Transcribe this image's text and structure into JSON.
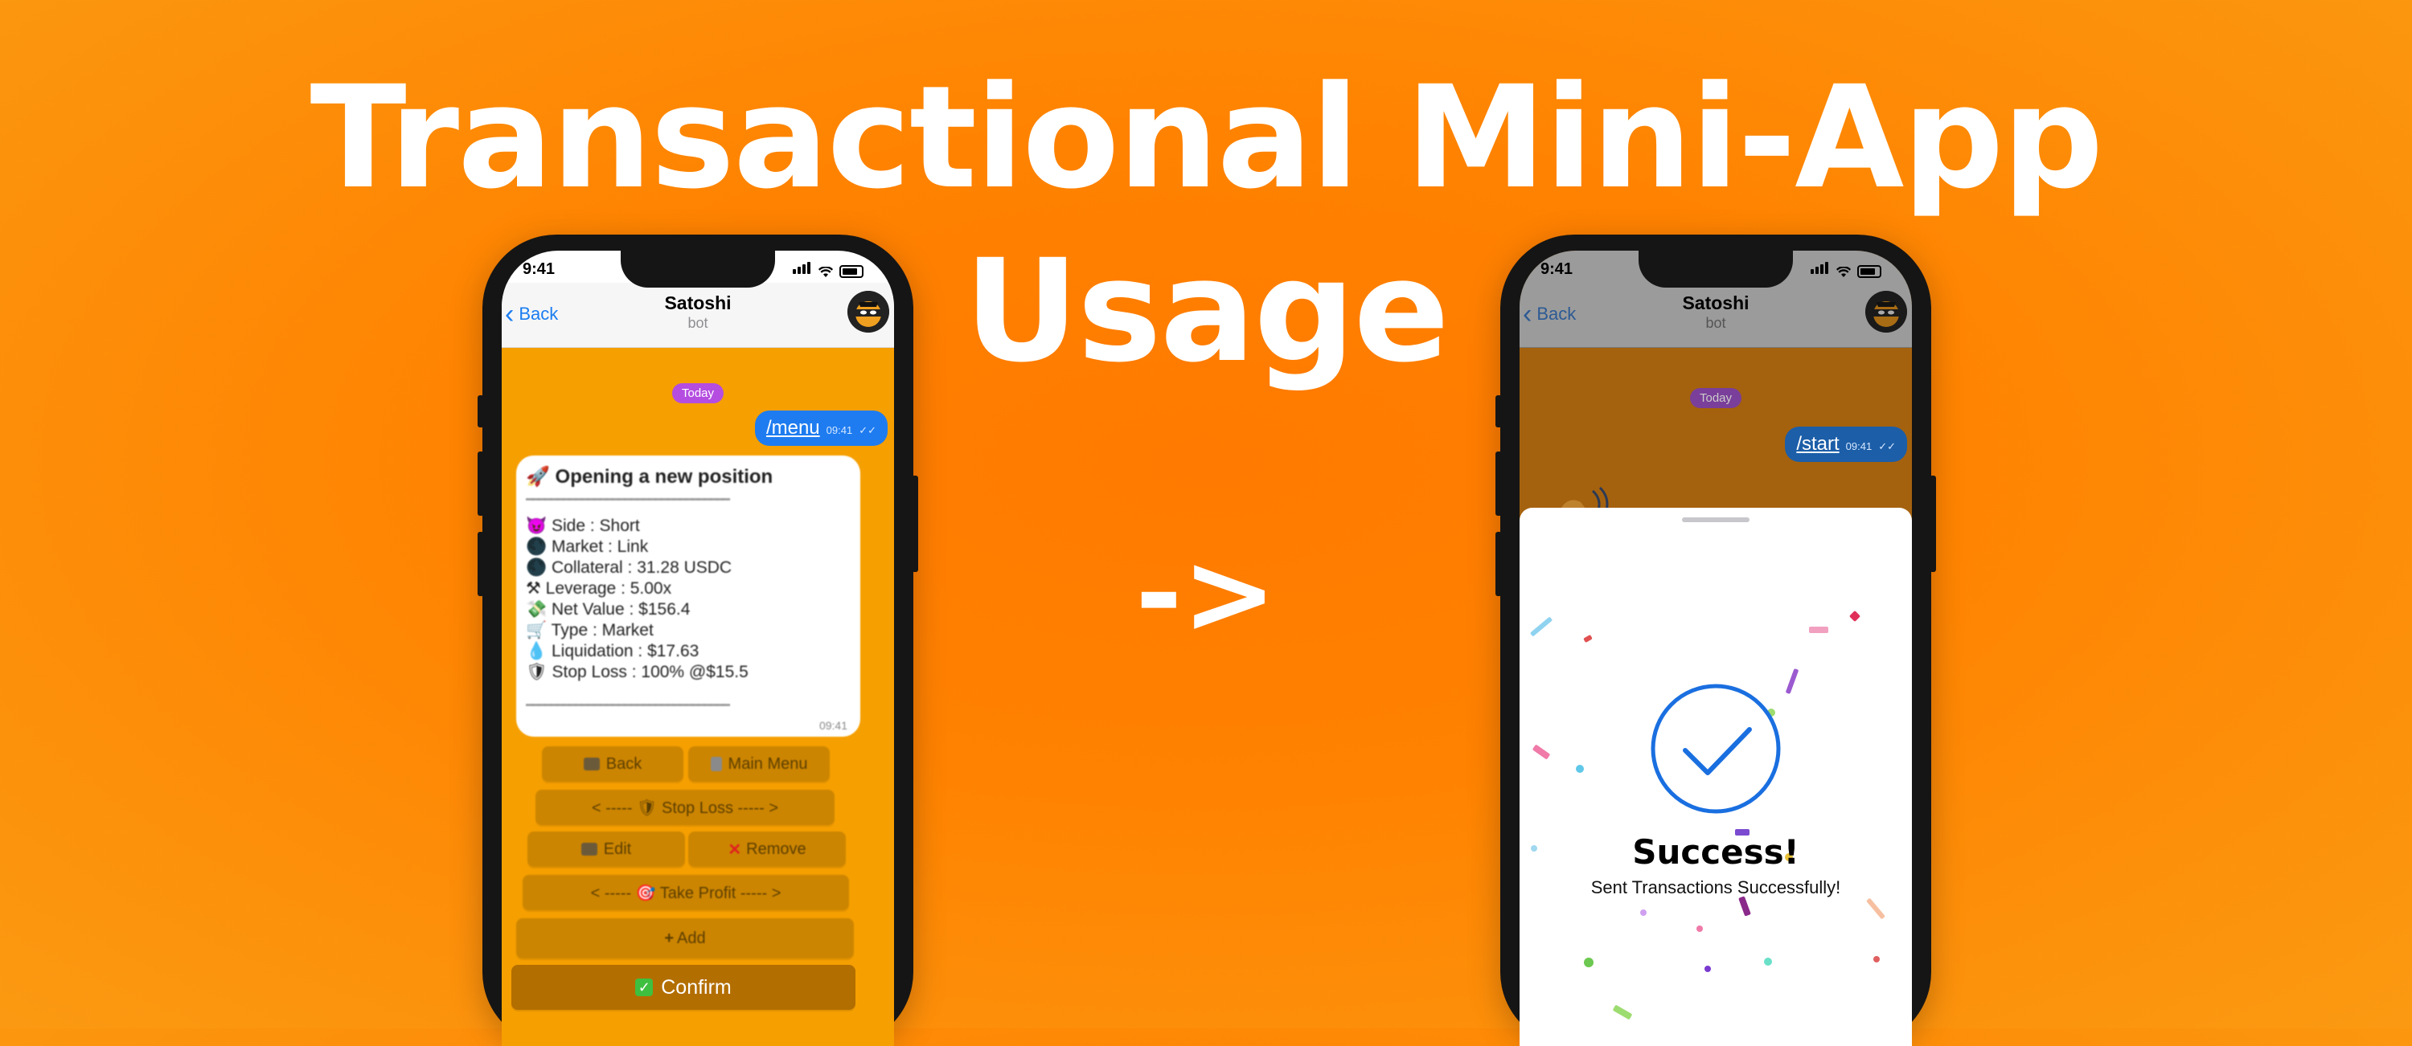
{
  "headline": {
    "line1": "Transactional Mini-App",
    "line2": "Usage"
  },
  "transition_arrow": "->",
  "left_phone": {
    "status_time": "9:41",
    "header": {
      "back_label": "Back",
      "title": "Satoshi",
      "subtitle": "bot"
    },
    "date_pill": "Today",
    "outgoing": {
      "text": "/menu",
      "time": "09:41"
    },
    "message": {
      "title": "🚀 Opening a new position",
      "separator": "━━━━━━━━━━━━━━━━━━━━━━━━━━━━━━━━━",
      "rows": [
        "😈 Side :   Short",
        "🌑 Market :   Link",
        "🌑 Collateral :   31.28 USDC",
        "⚒ Leverage :   5.00x",
        "💸 Net Value :   $156.4",
        "🛒 Type :   Market",
        "💧 Liquidation : $17.63",
        "🛡 Stop Loss :   100% @$15.5"
      ],
      "time": "09:41"
    },
    "keyboard": {
      "back": "Back",
      "main_menu": "Main Menu",
      "stop_loss": "< ----- 🛡 Stop Loss ----- >",
      "edit": "Edit",
      "remove": "Remove",
      "take_profit": "< ----- 🎯 Take Profit ----- >",
      "add": "Add",
      "confirm": "Confirm"
    }
  },
  "right_phone": {
    "status_time": "9:41",
    "header": {
      "back_label": "Back",
      "title": "Satoshi",
      "subtitle": "bot"
    },
    "date_pill": "Today",
    "outgoing": {
      "text": "/start",
      "time": "09:41"
    },
    "sheet": {
      "title": "Success!",
      "subtitle": "Sent Transactions Successfully!"
    }
  },
  "colors": {
    "background": "#ff8200",
    "chat_bg": "#f59f00",
    "bubble_blue": "#1e7cf0",
    "success_blue": "#1a6fe0",
    "keyboard_button": "#cc8500"
  }
}
